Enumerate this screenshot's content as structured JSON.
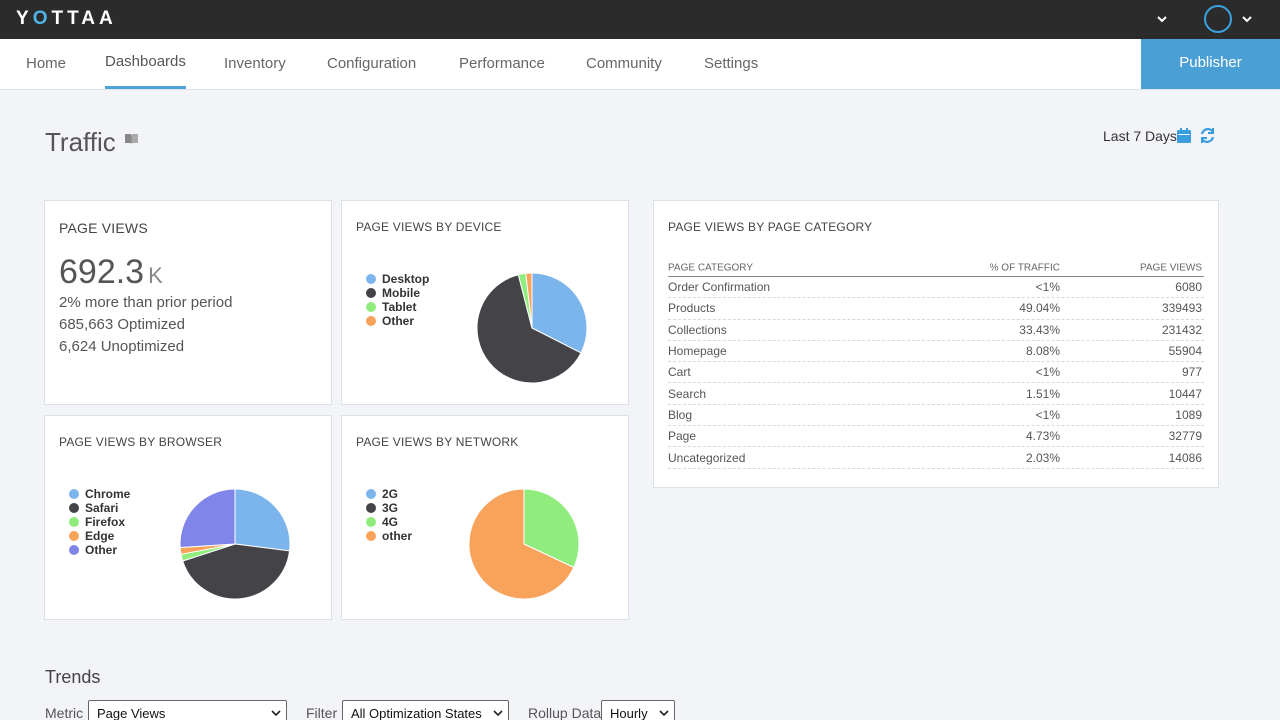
{
  "brand": {
    "logo": "YOTTAA"
  },
  "nav": {
    "items": [
      {
        "label": "Home"
      },
      {
        "label": "Dashboards"
      },
      {
        "label": "Inventory"
      },
      {
        "label": "Configuration"
      },
      {
        "label": "Performance"
      },
      {
        "label": "Community"
      },
      {
        "label": "Settings"
      }
    ],
    "active": "Dashboards",
    "publisher_label": "Publisher"
  },
  "header": {
    "title": "Traffic",
    "date_range": "Last 7 Days"
  },
  "page_views": {
    "title": "PAGE VIEWS",
    "value": "692.3",
    "unit": "K",
    "change": "2% more than prior period",
    "optimized": "685,663 Optimized",
    "unoptimized": "6,624 Unoptimized"
  },
  "device": {
    "title": "PAGE VIEWS BY DEVICE",
    "legend": [
      "Desktop",
      "Mobile",
      "Tablet",
      "Other"
    ],
    "colors": [
      "#7cb5ec",
      "#434348",
      "#90ed7d",
      "#f7a35c"
    ],
    "values": [
      32.5,
      63.5,
      2.2,
      1.8
    ]
  },
  "browser": {
    "title": "PAGE VIEWS BY BROWSER",
    "legend": [
      "Chrome",
      "Safari",
      "Firefox",
      "Edge",
      "Other"
    ],
    "colors": [
      "#7cb5ec",
      "#434348",
      "#90ed7d",
      "#f7a35c",
      "#8085e9"
    ],
    "values": [
      27,
      43,
      2,
      2,
      26
    ]
  },
  "network": {
    "title": "PAGE VIEWS BY NETWORK",
    "legend": [
      "2G",
      "3G",
      "4G",
      "other"
    ],
    "colors": [
      "#7cb5ec",
      "#434348",
      "#90ed7d",
      "#f7a35c"
    ],
    "values": [
      0,
      0,
      32,
      68
    ]
  },
  "category": {
    "title": "PAGE VIEWS BY PAGE CATEGORY",
    "headers": [
      "PAGE CATEGORY",
      "% OF TRAFFIC",
      "PAGE VIEWS"
    ],
    "rows": [
      [
        "Order Confirmation",
        "<1%",
        "6080"
      ],
      [
        "Products",
        "49.04%",
        "339493"
      ],
      [
        "Collections",
        "33.43%",
        "231432"
      ],
      [
        "Homepage",
        "8.08%",
        "55904"
      ],
      [
        "Cart",
        "<1%",
        "977"
      ],
      [
        "Search",
        "1.51%",
        "10447"
      ],
      [
        "Blog",
        "<1%",
        "1089"
      ],
      [
        "Page",
        "4.73%",
        "32779"
      ],
      [
        "Uncategorized",
        "2.03%",
        "14086"
      ]
    ]
  },
  "trends": {
    "title": "Trends",
    "metric_label": "Metric",
    "metric_value": "Page Views",
    "filter_label": "Filter",
    "filter_value": "All Optimization States",
    "rollup_label": "Rollup Data",
    "rollup_value": "Hourly"
  }
}
